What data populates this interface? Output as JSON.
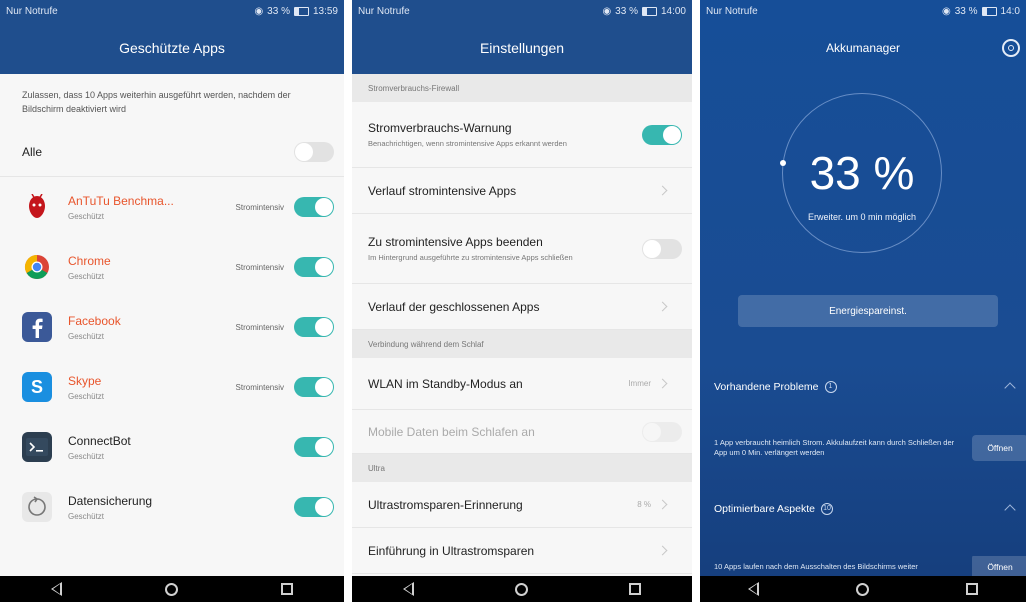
{
  "p1": {
    "carrier": "Nur Notrufe",
    "battery": "33 %",
    "time": "13:59",
    "title": "Geschützte Apps",
    "description": "Zulassen, dass 10 Apps weiterhin ausgeführt werden, nachdem der Bildschirm deaktiviert wird",
    "all_label": "Alle",
    "apps": [
      {
        "name": "AnTuTu Benchma...",
        "sub": "Geschützt",
        "tag": "Stromintensiv",
        "icon": "antutu-icon"
      },
      {
        "name": "Chrome",
        "sub": "Geschützt",
        "tag": "Stromintensiv",
        "icon": "chrome-icon"
      },
      {
        "name": "Facebook",
        "sub": "Geschützt",
        "tag": "Stromintensiv",
        "icon": "facebook-icon"
      },
      {
        "name": "Skype",
        "sub": "Geschützt",
        "tag": "Stromintensiv",
        "icon": "skype-icon"
      },
      {
        "name": "ConnectBot",
        "sub": "Geschützt",
        "tag": "",
        "icon": "connectbot-icon"
      },
      {
        "name": "Datensicherung",
        "sub": "Geschützt",
        "tag": "",
        "icon": "backup-icon"
      }
    ]
  },
  "p2": {
    "carrier": "Nur Notrufe",
    "battery": "33 %",
    "time": "14:00",
    "title": "Einstellungen",
    "sections": [
      {
        "header": "Stromverbrauchs-Firewall"
      },
      {
        "header": "Verbindung während dem Schlaf"
      },
      {
        "header": "Ultra"
      }
    ],
    "rows": [
      {
        "title": "Stromverbrauchs-Warnung",
        "desc": "Benachrichtigen, wenn stromintensive Apps erkannt werden"
      },
      {
        "title": "Verlauf stromintensive Apps"
      },
      {
        "title": "Zu stromintensive Apps beenden",
        "desc": "Im Hintergrund ausgeführte zu stromintensive Apps schließen"
      },
      {
        "title": "Verlauf der geschlossenen Apps"
      },
      {
        "title": "WLAN im Standby-Modus an",
        "value": "Immer"
      },
      {
        "title": "Mobile Daten beim Schlafen an"
      },
      {
        "title": "Ultrastromsparen-Erinnerung",
        "value": "8 %"
      },
      {
        "title": "Einführung in Ultrastromsparen"
      }
    ]
  },
  "p3": {
    "carrier": "Nur Notrufe",
    "battery": "33 %",
    "time": "14:0",
    "title": "Akkumanager",
    "percent": "33 %",
    "extend": "Erweiter. um 0 min möglich",
    "energy_button": "Energiespareinst.",
    "problems_header": "Vorhandene Probleme",
    "problems_count": "1",
    "problem_text": "1 App verbraucht heimlich Strom. Akkulaufzeit kann durch Schließen der App um 0 Min. verlängert werden",
    "open_label": "Öffnen",
    "optim_header": "Optimierbare Aspekte",
    "optim_count": "10",
    "optim_text": "10 Apps laufen nach dem Ausschalten des Bildschirms weiter"
  },
  "colors": {
    "accent": "#37b7b0",
    "bar": "#1f4e8d",
    "hot_app": "#e8552c"
  }
}
